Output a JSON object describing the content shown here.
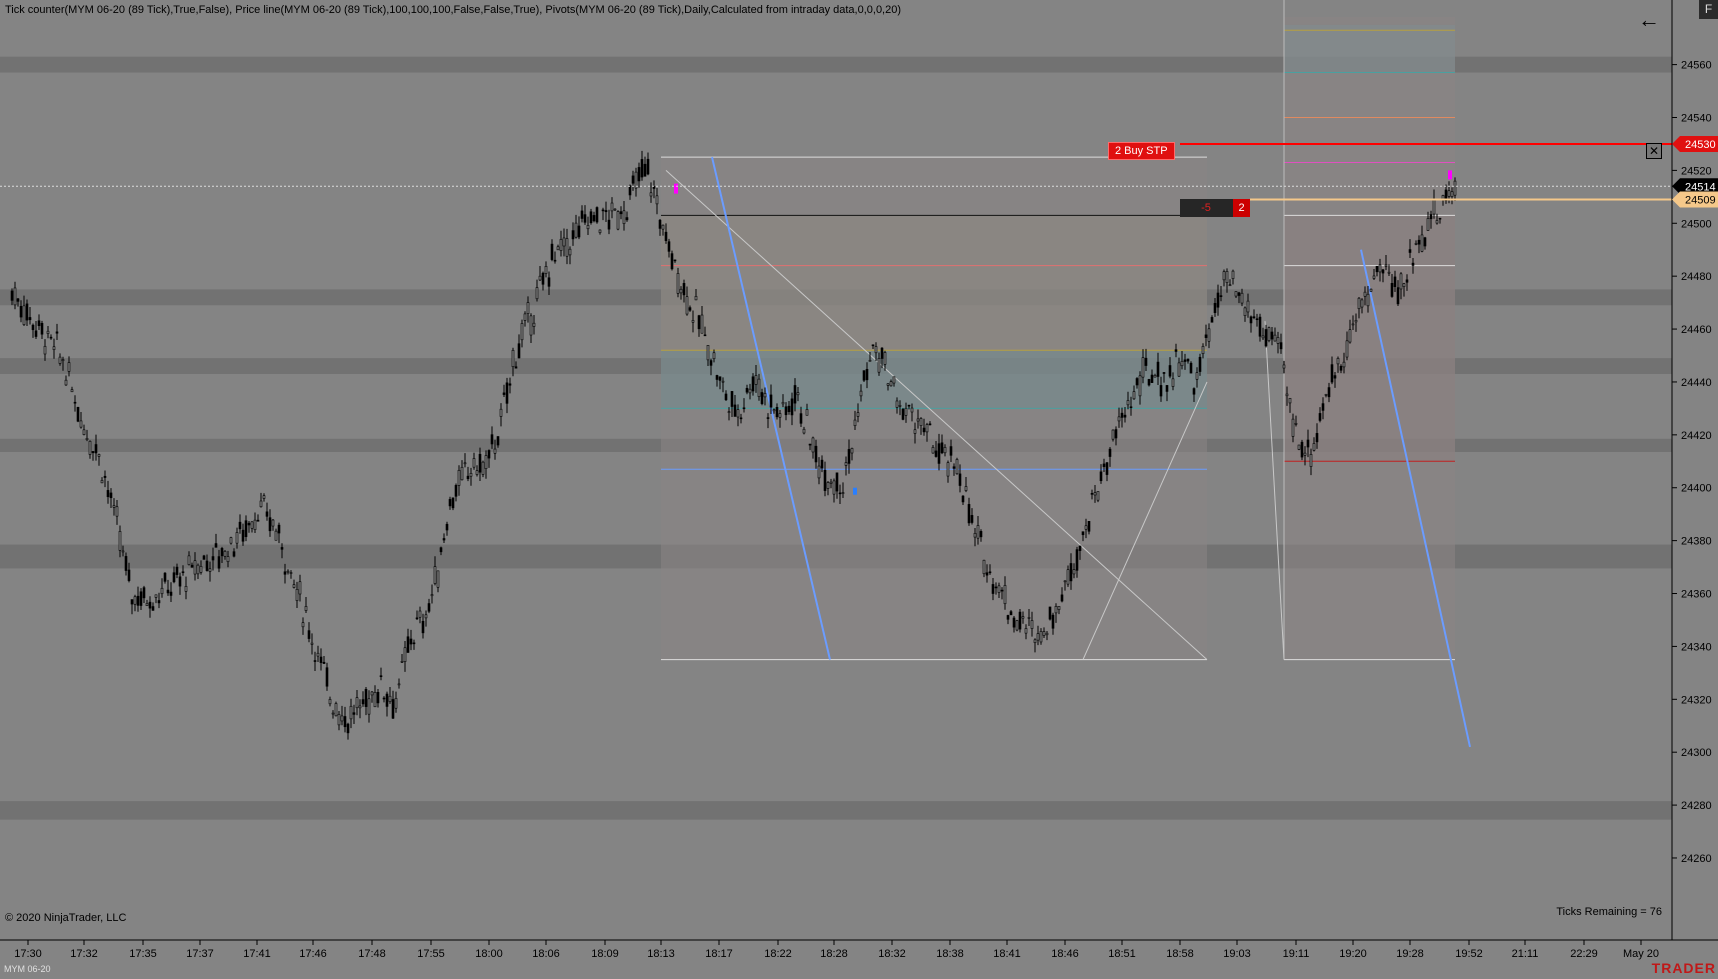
{
  "indicator_label": "Tick counter(MYM 06-20 (89 Tick),True,False), Price line(MYM 06-20 (89 Tick),100,100,100,False,False,True), Pivots(MYM 06-20 (89 Tick),Daily,Calculated from intraday data,0,0,0,20)",
  "copyright": "© 2020 NinjaTrader, LLC",
  "ticks_remaining": "Ticks Remaining = 76",
  "instrument": "MYM 06-20",
  "brand": "TRADER",
  "f_button": "F",
  "back_icon": "←",
  "order": {
    "label": "2  Buy STP",
    "price": "24530",
    "close_symbol": "✕"
  },
  "position": {
    "pnl": "-5",
    "qty": "2",
    "price": "24509"
  },
  "last_price": "24514",
  "colors": {
    "order_line": "#ff0000",
    "position_line": "#f5c88a",
    "trend_line": "#6b9cff",
    "axis_bg": "#848484",
    "bar_color": "#000000"
  },
  "chart_data": {
    "type": "candlestick",
    "ylim": [
      24246,
      24578
    ],
    "y_ticks": [
      "24260",
      "24280",
      "24300",
      "24320",
      "24340",
      "24360",
      "24380",
      "24400",
      "24420",
      "24440",
      "24460",
      "24480",
      "24500",
      "24520",
      "24540",
      "24560"
    ],
    "x_ticks": [
      "17:30",
      "17:32",
      "17:35",
      "17:37",
      "17:41",
      "17:46",
      "17:48",
      "17:55",
      "18:00",
      "18:06",
      "18:09",
      "18:13",
      "18:17",
      "18:22",
      "18:28",
      "18:32",
      "18:38",
      "18:41",
      "18:46",
      "18:51",
      "18:58",
      "19:03",
      "19:11",
      "19:20",
      "19:28",
      "19:52",
      "21:11",
      "22:29",
      "May 20"
    ],
    "price_path": [
      [
        0,
        24474
      ],
      [
        2.4,
        24462
      ],
      [
        5,
        24450
      ],
      [
        7.2,
        24425
      ],
      [
        9,
        24412
      ],
      [
        10.8,
        24385
      ],
      [
        12.2,
        24360
      ],
      [
        14,
        24358
      ],
      [
        15.8,
        24362
      ],
      [
        17.5,
        24366
      ],
      [
        19.5,
        24372
      ],
      [
        21.5,
        24375
      ],
      [
        24,
        24385
      ],
      [
        25.3,
        24392
      ],
      [
        27,
        24385
      ],
      [
        29.5,
        24358
      ],
      [
        31.5,
        24335
      ],
      [
        32.6,
        24322
      ],
      [
        34.2,
        24312
      ],
      [
        36,
        24318
      ],
      [
        38,
        24326
      ],
      [
        39.2,
        24318
      ],
      [
        41,
        24345
      ],
      [
        42.3,
        24350
      ],
      [
        43.5,
        24366
      ],
      [
        45,
        24396
      ],
      [
        47,
        24408
      ],
      [
        48.5,
        24408
      ],
      [
        50,
        24422
      ],
      [
        51.5,
        24450
      ],
      [
        53.5,
        24468
      ],
      [
        55.5,
        24488
      ],
      [
        57,
        24492
      ],
      [
        59,
        24502
      ],
      [
        61.3,
        24502
      ],
      [
        63,
        24506
      ],
      [
        64.3,
        24518
      ],
      [
        65.2,
        24520
      ],
      [
        66,
        24508
      ],
      [
        67.5,
        24488
      ],
      [
        69,
        24474
      ],
      [
        71,
        24458
      ],
      [
        73,
        24436
      ],
      [
        74.3,
        24428
      ],
      [
        76,
        24442
      ],
      [
        77.5,
        24432
      ],
      [
        79,
        24428
      ],
      [
        80.4,
        24436
      ],
      [
        82.3,
        24412
      ],
      [
        83.8,
        24404
      ],
      [
        85.2,
        24403
      ],
      [
        86.2,
        24418
      ],
      [
        87.3,
        24440
      ],
      [
        88.2,
        24452
      ],
      [
        89.4,
        24446
      ],
      [
        91,
        24430
      ],
      [
        92.6,
        24426
      ],
      [
        94.5,
        24416
      ],
      [
        95.5,
        24410
      ],
      [
        97,
        24408
      ],
      [
        98.5,
        24384
      ],
      [
        99.8,
        24372
      ],
      [
        101.5,
        24360
      ],
      [
        102.5,
        24352
      ],
      [
        104.3,
        24346
      ],
      [
        105.8,
        24346
      ],
      [
        107.7,
        24360
      ],
      [
        109.5,
        24380
      ],
      [
        110.5,
        24390
      ],
      [
        112,
        24408
      ],
      [
        114,
        24428
      ],
      [
        115,
        24436
      ],
      [
        116.3,
        24444
      ],
      [
        118.2,
        24440
      ],
      [
        120,
        24450
      ],
      [
        121.3,
        24438
      ],
      [
        122.8,
        24462
      ],
      [
        124.5,
        24478
      ],
      [
        126,
        24470
      ],
      [
        128,
        24460
      ],
      [
        130,
        24452
      ],
      [
        131.4,
        24422
      ],
      [
        133,
        24412
      ],
      [
        134.5,
        24432
      ],
      [
        136.5,
        24452
      ],
      [
        138.5,
        24470
      ],
      [
        140.3,
        24484
      ],
      [
        142.3,
        24474
      ],
      [
        144.3,
        24496
      ],
      [
        145.8,
        24502
      ],
      [
        147.2,
        24510
      ],
      [
        148,
        24514
      ]
    ]
  }
}
